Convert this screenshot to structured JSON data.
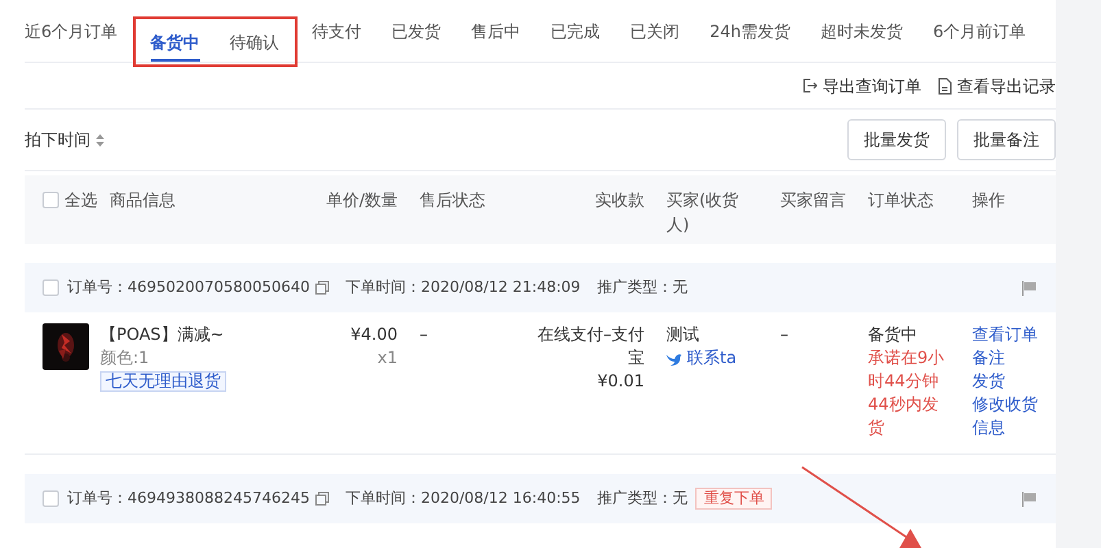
{
  "tabs": [
    {
      "label": "近6个月订单",
      "selected": false,
      "annotated": false
    },
    {
      "label": "备货中",
      "selected": true,
      "annotated": true
    },
    {
      "label": "待确认",
      "selected": false,
      "annotated": true
    },
    {
      "label": "待支付",
      "selected": false,
      "annotated": false
    },
    {
      "label": "已发货",
      "selected": false,
      "annotated": false
    },
    {
      "label": "售后中",
      "selected": false,
      "annotated": false
    },
    {
      "label": "已完成",
      "selected": false,
      "annotated": false
    },
    {
      "label": "已关闭",
      "selected": false,
      "annotated": false
    },
    {
      "label": "24h需发货",
      "selected": false,
      "annotated": false
    },
    {
      "label": "超时未发货",
      "selected": false,
      "annotated": false
    },
    {
      "label": "6个月前订单",
      "selected": false,
      "annotated": false
    }
  ],
  "export_links": [
    {
      "kind": "export",
      "label": "导出查询订单"
    },
    {
      "kind": "record",
      "label": "查看导出记录"
    }
  ],
  "sort": {
    "label": "拍下时间"
  },
  "bulk_buttons": [
    "批量发货",
    "批量备注"
  ],
  "table": {
    "select_all": {
      "label": "全选",
      "checked": false
    },
    "columns": [
      "商品信息",
      "单价/数量",
      "售后状态",
      "实收款",
      "买家(收货人)",
      "买家留言",
      "订单状态",
      "操作"
    ]
  },
  "orders": [
    {
      "checked": false,
      "order_no": "订单号：4695020070580050640",
      "time": "下单时间：2020/08/12 21:48:09",
      "promo": "推广类型：无",
      "item": {
        "title": "【POAS】满减~",
        "spec": "颜色:1",
        "service_tag": "七天无理由退货",
        "price": "¥4.00",
        "qty": "x1",
        "after_sale": "–",
        "payment": "在线支付–支付宝",
        "amount": "¥0.01",
        "buyer": "测试",
        "contact": "联系ta",
        "message": "–",
        "status": "备货中",
        "promise": "承诺在9小时44分钟44秒内发货",
        "actions": [
          "查看订单",
          "备注",
          "发货",
          "修改收货信息"
        ]
      }
    },
    {
      "checked": false,
      "order_no": "订单号：4694938088245746245",
      "time": "下单时间：2020/08/12 16:40:55",
      "promo": "推广类型：无",
      "tags": [
        "重复下单"
      ]
    }
  ]
}
